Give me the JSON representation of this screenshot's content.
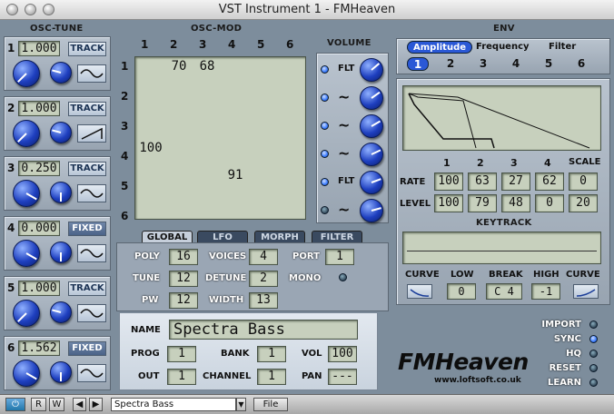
{
  "window": {
    "title": "VST Instrument 1 - FMHeaven"
  },
  "osc_tune": {
    "title": "OSC-TUNE",
    "oscs": [
      {
        "num": "1",
        "value": "1.000",
        "mode": "TRACK",
        "wave": "sine",
        "level": 0.65
      },
      {
        "num": "2",
        "value": "1.000",
        "mode": "TRACK",
        "wave": "ramp",
        "level": 0.65
      },
      {
        "num": "3",
        "value": "0.250",
        "mode": "TRACK",
        "wave": "sine",
        "level": 0.3
      },
      {
        "num": "4",
        "value": "0.000",
        "mode": "FIXED",
        "wave": "sine",
        "level": 0.3
      },
      {
        "num": "5",
        "value": "1.000",
        "mode": "TRACK",
        "wave": "sine",
        "level": 0.65
      },
      {
        "num": "6",
        "value": "1.562",
        "mode": "FIXED",
        "wave": "sine",
        "level": 0.3
      }
    ]
  },
  "osc_mod": {
    "title": "OSC-MOD",
    "cols": [
      "1",
      "2",
      "3",
      "4",
      "5",
      "6"
    ],
    "rows": [
      "1",
      "2",
      "3",
      "4",
      "5",
      "6"
    ],
    "cells": [
      [
        "",
        "70",
        "68",
        "",
        "",
        ""
      ],
      [
        "",
        "",
        "",
        "",
        "",
        ""
      ],
      [
        "",
        "",
        "",
        "",
        "",
        ""
      ],
      [
        "100",
        "",
        "",
        "",
        "",
        ""
      ],
      [
        "",
        "",
        "",
        "91",
        "",
        ""
      ],
      [
        "",
        "",
        "",
        "",
        "",
        ""
      ]
    ]
  },
  "volume": {
    "title": "VOLUME",
    "rows": [
      {
        "mode": "FLT",
        "led": true
      },
      {
        "mode": "~",
        "led": true
      },
      {
        "mode": "~",
        "led": true
      },
      {
        "mode": "~",
        "led": true
      },
      {
        "mode": "FLT",
        "led": true
      },
      {
        "mode": "~",
        "led": false
      }
    ]
  },
  "env": {
    "title": "ENV",
    "tabs": [
      "Amplitude",
      "Frequency",
      "Filter"
    ],
    "selected_tab": "Amplitude",
    "nums": [
      "1",
      "2",
      "3",
      "4",
      "5",
      "6"
    ],
    "selected_num": "1",
    "stage_labels": [
      "1",
      "2",
      "3",
      "4",
      "SCALE"
    ],
    "rate_label": "RATE",
    "rate": [
      "100",
      "63",
      "27",
      "62",
      "0"
    ],
    "level_label": "LEVEL",
    "level": [
      "100",
      "79",
      "48",
      "0",
      "20"
    ],
    "keytrack_title": "KEYTRACK",
    "curve_label": "CURVE",
    "low_label": "LOW",
    "break_label": "BREAK",
    "high_label": "HIGH",
    "curve2_label": "CURVE",
    "low": "0",
    "break": "C 4",
    "high": "-1"
  },
  "global": {
    "tabs": [
      "GLOBAL",
      "LFO",
      "MORPH",
      "FILTER"
    ],
    "selected_tab": "GLOBAL",
    "poly_label": "POLY",
    "poly": "16",
    "voices_label": "VOICES",
    "voices": "4",
    "port_label": "PORT",
    "port": "1",
    "tune_label": "TUNE",
    "tune": "12",
    "detune_label": "DETUNE",
    "detune": "2",
    "mono_label": "MONO",
    "pw_label": "PW",
    "pw": "12",
    "width_label": "WIDTH",
    "width": "13"
  },
  "patch": {
    "name_label": "NAME",
    "name": "Spectra Bass",
    "prog_label": "PROG",
    "prog": "1",
    "bank_label": "BANK",
    "bank": "1",
    "vol_label": "VOL",
    "vol": "100",
    "out_label": "OUT",
    "out": "1",
    "channel_label": "CHANNEL",
    "channel": "1",
    "pan_label": "PAN",
    "pan": "---"
  },
  "options": [
    {
      "label": "IMPORT",
      "led": false
    },
    {
      "label": "SYNC",
      "led": true
    },
    {
      "label": "HQ",
      "led": false
    },
    {
      "label": "RESET",
      "led": false
    },
    {
      "label": "LEARN",
      "led": false
    }
  ],
  "logo": {
    "name": "FMHeaven",
    "url": "www.loftsoft.co.uk"
  },
  "bottom": {
    "power": "⏻",
    "r": "R",
    "w": "W",
    "prev": "◀",
    "next": "▶",
    "preset": "Spectra Bass",
    "file": "File"
  }
}
